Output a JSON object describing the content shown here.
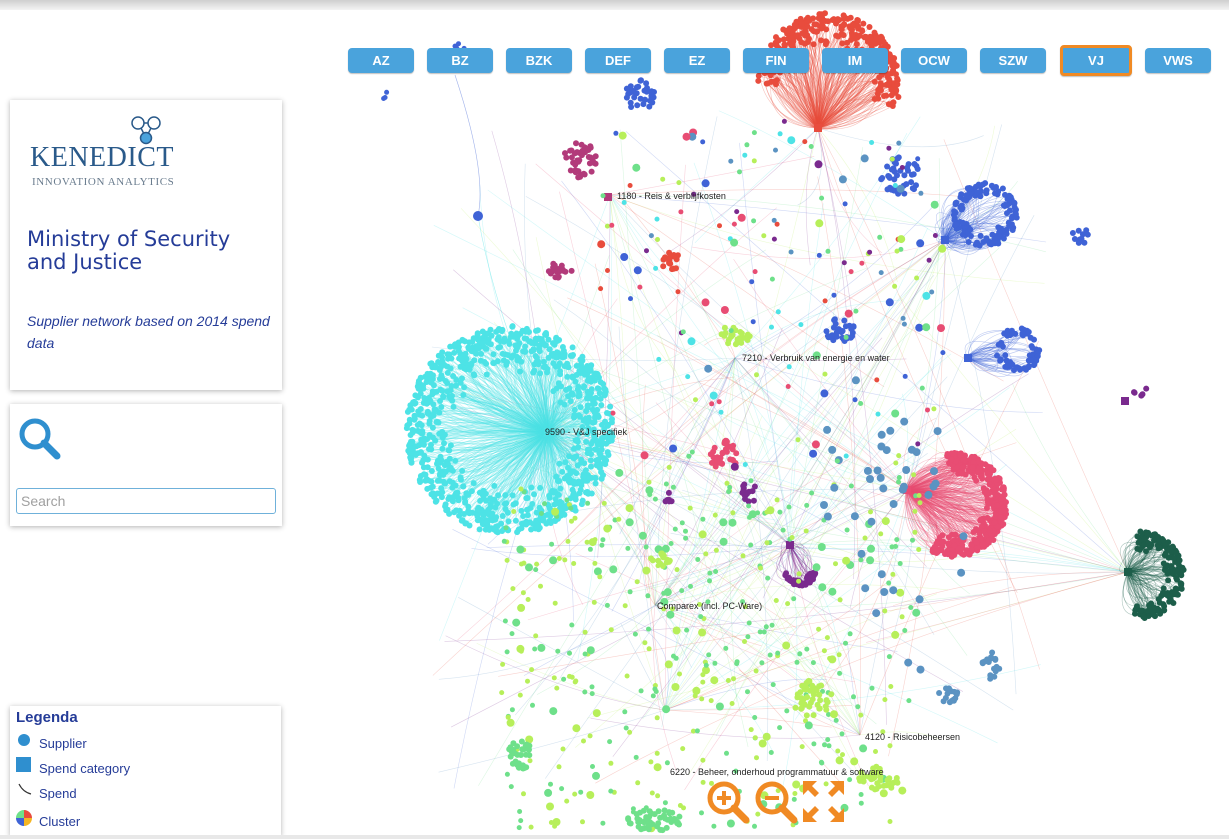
{
  "nav": {
    "buttons": [
      "AZ",
      "BZ",
      "BZK",
      "DEF",
      "EZ",
      "FIN",
      "IM",
      "OCW",
      "SZW",
      "VJ",
      "VWS"
    ],
    "active": "VJ"
  },
  "logo": {
    "name": "KENEDICT",
    "tagline": "INNOVATION ANALYTICS"
  },
  "info": {
    "ministry": "Ministry of Security and Justice",
    "subtitle": "Supplier network based on 2014 spend data"
  },
  "search": {
    "placeholder": "Search",
    "value": ""
  },
  "legend": {
    "title": "Legenda",
    "items": [
      "Supplier",
      "Spend category",
      "Spend",
      "Cluster"
    ]
  },
  "graph_labels": {
    "reis": "1180 - Reis & verblijfkosten",
    "energie": "7210 - Verbruik van energie en water",
    "vj": "9590 - V&J specifiek",
    "comparex": "Comparex (incl. PC-Ware)",
    "risico": "4120 - Risicobeheersen",
    "beheer": "6220 - Beheer, onderhoud programmatuur & software"
  },
  "colors": {
    "accent": "#4aa3dc",
    "active_border": "#f08a24",
    "zoom_controls": "#f08a24",
    "text_blue": "#253c98",
    "cyan_cluster": "#4de3e6",
    "red_cluster": "#e84c3d",
    "pink_cluster": "#e84d73",
    "blue_cluster": "#3f63d6",
    "teal_cluster": "#1d5e4a",
    "green_cluster": "#6ee08a",
    "lime_cluster": "#b7ef5a",
    "purple_cluster": "#7a2a8e",
    "magenta_cluster": "#b23a7a",
    "steel_cluster": "#5b93c2"
  },
  "controls": [
    "zoom-in-icon",
    "zoom-out-icon",
    "fit-screen-icon"
  ]
}
